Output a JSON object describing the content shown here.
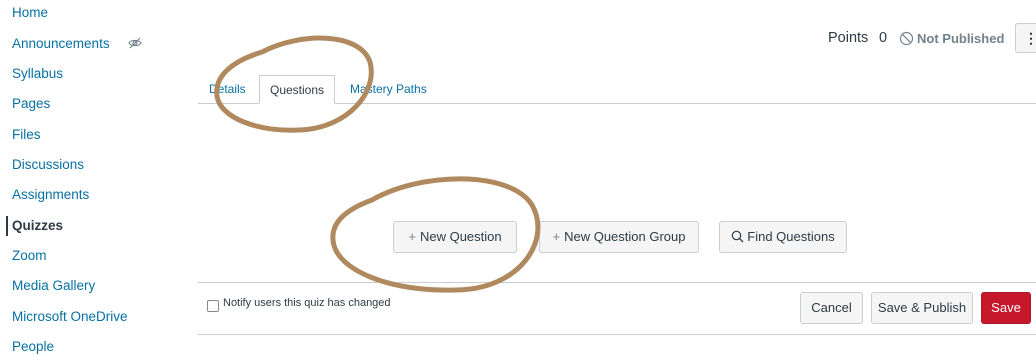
{
  "sidebar": {
    "items": [
      {
        "label": "Home"
      },
      {
        "label": "Announcements"
      },
      {
        "label": "Syllabus"
      },
      {
        "label": "Pages"
      },
      {
        "label": "Files"
      },
      {
        "label": "Discussions"
      },
      {
        "label": "Assignments"
      },
      {
        "label": "Quizzes"
      },
      {
        "label": "Zoom"
      },
      {
        "label": "Media Gallery"
      },
      {
        "label": "Microsoft OneDrive"
      },
      {
        "label": "People"
      }
    ],
    "active": "Quizzes",
    "hidden_icon": "eye-slash-icon"
  },
  "header": {
    "points_label": "Points",
    "points_value": "0",
    "status": "Not Published",
    "status_icon": "not-published-icon",
    "menu_icon": "⋮"
  },
  "tabs": [
    {
      "label": "Details"
    },
    {
      "label": "Questions"
    },
    {
      "label": "Mastery Paths"
    }
  ],
  "active_tab": "Questions",
  "question_actions": {
    "new_question": "New Question",
    "new_question_group": "New Question Group",
    "find_questions": "Find Questions",
    "plus_glyph": "+",
    "search_glyph": "⌕"
  },
  "footer": {
    "notify_label": "Notify users this quiz has changed",
    "cancel": "Cancel",
    "save_publish": "Save & Publish",
    "save": "Save"
  },
  "colors": {
    "link": "#0770a3",
    "primary_button": "#c5182b",
    "annotation": "#b08a5e"
  }
}
